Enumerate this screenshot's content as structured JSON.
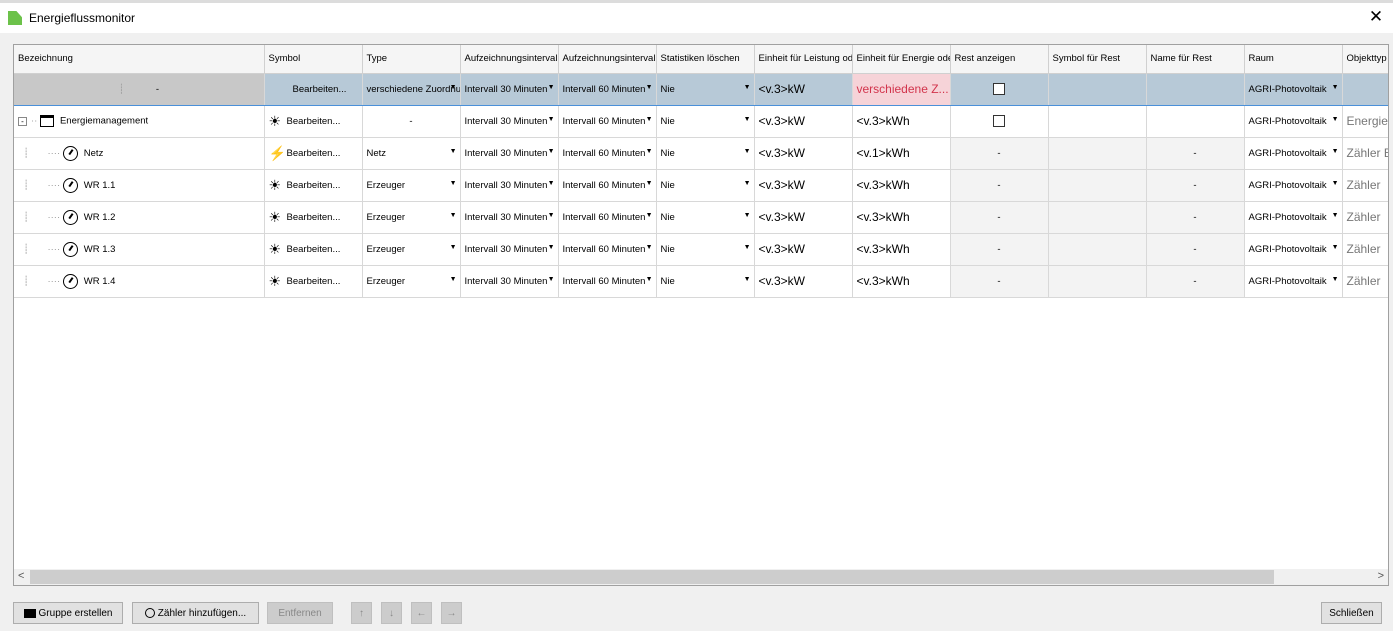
{
  "window": {
    "title": "Energieflussmonitor",
    "close": "✕"
  },
  "columns": [
    "Bezeichnung",
    "Symbol",
    "Type",
    "Aufzeichnungsintervall",
    "Aufzeichnungsintervall",
    "Statistiken löschen",
    "Einheit für Leistung oder",
    "Einheit für Energie oder",
    "Rest anzeigen",
    "Symbol für Rest",
    "Name für Rest",
    "Raum",
    "Objekttyp"
  ],
  "rows": [
    {
      "name": "-",
      "symbol": "Bearbeiten...",
      "type": "verschiedene Zuordnungen",
      "int1": "Intervall 30 Minuten",
      "int2": "Intervall 60 Minuten",
      "stat": "Nie",
      "power": "<v.3>kW",
      "energy": "verschiedene Z...",
      "rest": "",
      "restsym": "",
      "restname": "",
      "room": "AGRI-Photovoltaik",
      "obj": ""
    },
    {
      "name": "Energiemanagement",
      "symbol": "Bearbeiten...",
      "type": "-",
      "int1": "Intervall 30 Minuten",
      "int2": "Intervall 60 Minuten",
      "stat": "Nie",
      "power": "<v.3>kW",
      "energy": "<v.3>kWh",
      "rest": "",
      "restsym": "",
      "restname": "",
      "room": "AGRI-Photovoltaik",
      "obj": "Energiefluss"
    },
    {
      "name": "Netz",
      "symbol": "Bearbeiten...",
      "type": "Netz",
      "int1": "Intervall 30 Minuten",
      "int2": "Intervall 60 Minuten",
      "stat": "Nie",
      "power": "<v.3>kW",
      "energy": "<v.1>kWh",
      "rest": "-",
      "restsym": "",
      "restname": "-",
      "room": "AGRI-Photovoltaik",
      "obj": "Zähler Bezug"
    },
    {
      "name": "WR 1.1",
      "symbol": "Bearbeiten...",
      "type": "Erzeuger",
      "int1": "Intervall 30 Minuten",
      "int2": "Intervall 60 Minuten",
      "stat": "Nie",
      "power": "<v.3>kW",
      "energy": "<v.3>kWh",
      "rest": "-",
      "restsym": "",
      "restname": "-",
      "room": "AGRI-Photovoltaik",
      "obj": "Zähler"
    },
    {
      "name": "WR 1.2",
      "symbol": "Bearbeiten...",
      "type": "Erzeuger",
      "int1": "Intervall 30 Minuten",
      "int2": "Intervall 60 Minuten",
      "stat": "Nie",
      "power": "<v.3>kW",
      "energy": "<v.3>kWh",
      "rest": "-",
      "restsym": "",
      "restname": "-",
      "room": "AGRI-Photovoltaik",
      "obj": "Zähler"
    },
    {
      "name": "WR 1.3",
      "symbol": "Bearbeiten...",
      "type": "Erzeuger",
      "int1": "Intervall 30 Minuten",
      "int2": "Intervall 60 Minuten",
      "stat": "Nie",
      "power": "<v.3>kW",
      "energy": "<v.3>kWh",
      "rest": "-",
      "restsym": "",
      "restname": "-",
      "room": "AGRI-Photovoltaik",
      "obj": "Zähler"
    },
    {
      "name": "WR 1.4",
      "symbol": "Bearbeiten...",
      "type": "Erzeuger",
      "int1": "Intervall 30 Minuten",
      "int2": "Intervall 60 Minuten",
      "stat": "Nie",
      "power": "<v.3>kW",
      "energy": "<v.3>kWh",
      "rest": "-",
      "restsym": "",
      "restname": "-",
      "room": "AGRI-Photovoltaik",
      "obj": "Zähler"
    }
  ],
  "buttons": {
    "group": "Gruppe erstellen",
    "meter": "Zähler hinzufügen...",
    "remove": "Entfernen",
    "close": "Schließen",
    "up": "↑",
    "down": "↓",
    "left": "←",
    "right": "→"
  },
  "scroll": {
    "left": "<",
    "right": ">"
  }
}
